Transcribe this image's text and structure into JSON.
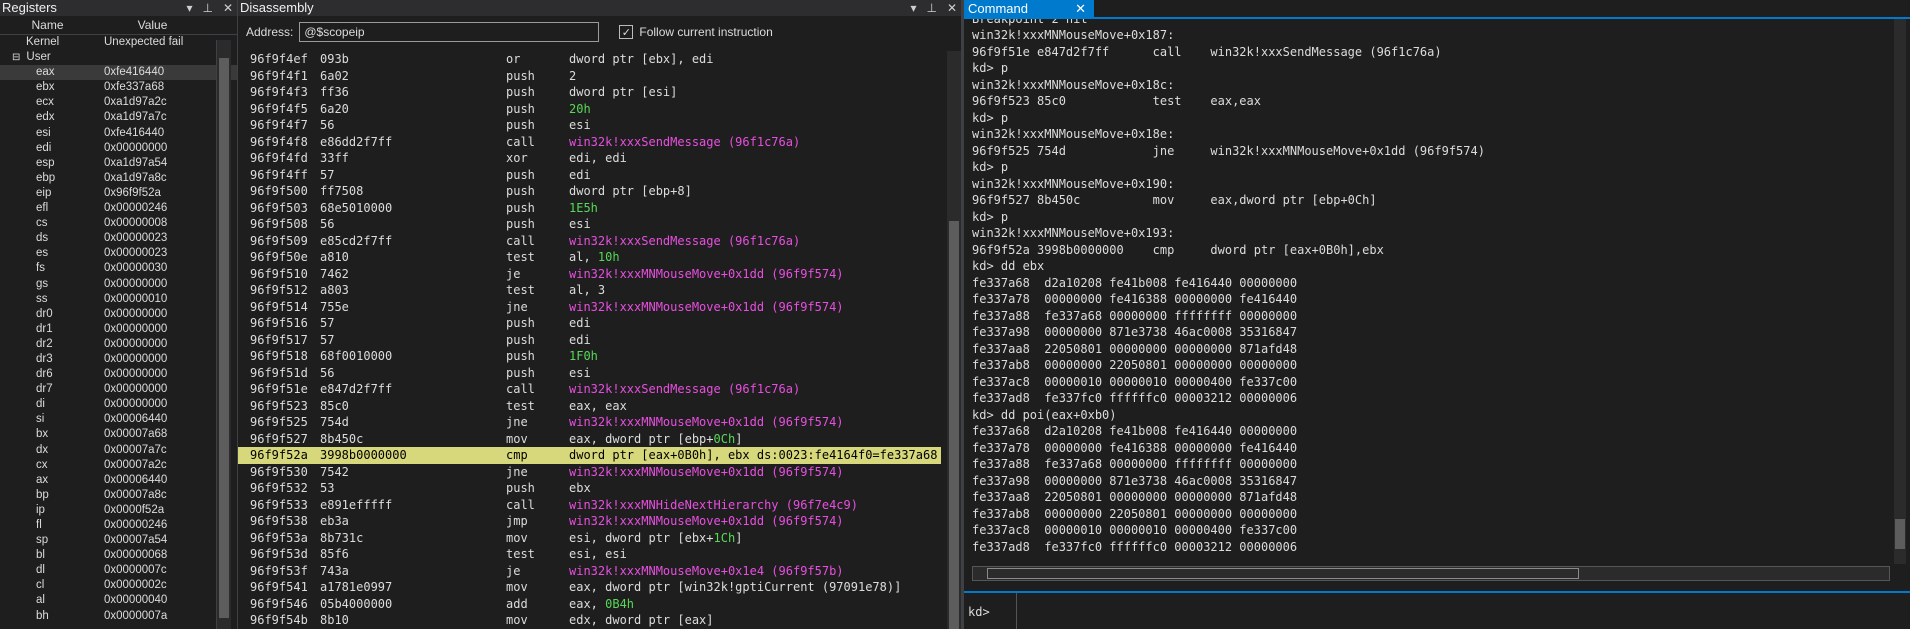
{
  "registers": {
    "title": "Registers",
    "col_name": "Name",
    "col_value": "Value",
    "kernel_row": {
      "name": "Kernel",
      "value": "Unexpected fail"
    },
    "group": "User",
    "rows": [
      {
        "name": "eax",
        "value": "0xfe416440"
      },
      {
        "name": "ebx",
        "value": "0xfe337a68"
      },
      {
        "name": "ecx",
        "value": "0xa1d97a2c"
      },
      {
        "name": "edx",
        "value": "0xa1d97a7c"
      },
      {
        "name": "esi",
        "value": "0xfe416440"
      },
      {
        "name": "edi",
        "value": "0x00000000"
      },
      {
        "name": "esp",
        "value": "0xa1d97a54"
      },
      {
        "name": "ebp",
        "value": "0xa1d97a8c"
      },
      {
        "name": "eip",
        "value": "0x96f9f52a"
      },
      {
        "name": "efl",
        "value": "0x00000246"
      },
      {
        "name": "cs",
        "value": "0x00000008"
      },
      {
        "name": "ds",
        "value": "0x00000023"
      },
      {
        "name": "es",
        "value": "0x00000023"
      },
      {
        "name": "fs",
        "value": "0x00000030"
      },
      {
        "name": "gs",
        "value": "0x00000000"
      },
      {
        "name": "ss",
        "value": "0x00000010"
      },
      {
        "name": "dr0",
        "value": "0x00000000"
      },
      {
        "name": "dr1",
        "value": "0x00000000"
      },
      {
        "name": "dr2",
        "value": "0x00000000"
      },
      {
        "name": "dr3",
        "value": "0x00000000"
      },
      {
        "name": "dr6",
        "value": "0x00000000"
      },
      {
        "name": "dr7",
        "value": "0x00000000"
      },
      {
        "name": "di",
        "value": "0x00000000"
      },
      {
        "name": "si",
        "value": "0x00006440"
      },
      {
        "name": "bx",
        "value": "0x00007a68"
      },
      {
        "name": "dx",
        "value": "0x00007a7c"
      },
      {
        "name": "cx",
        "value": "0x00007a2c"
      },
      {
        "name": "ax",
        "value": "0x00006440"
      },
      {
        "name": "bp",
        "value": "0x00007a8c"
      },
      {
        "name": "ip",
        "value": "0x0000f52a"
      },
      {
        "name": "fl",
        "value": "0x00000246"
      },
      {
        "name": "sp",
        "value": "0x00007a54"
      },
      {
        "name": "bl",
        "value": "0x00000068"
      },
      {
        "name": "dl",
        "value": "0x0000007c"
      },
      {
        "name": "cl",
        "value": "0x0000002c"
      },
      {
        "name": "al",
        "value": "0x00000040"
      },
      {
        "name": "bh",
        "value": "0x0000007a"
      }
    ]
  },
  "disassembly": {
    "title": "Disassembly",
    "address_label": "Address:",
    "address_value": "@$scopeip",
    "follow_label": "Follow current instruction",
    "lines": [
      {
        "addr": "96f9f4ef",
        "bytes": "093b",
        "mn": "or",
        "op": "dword ptr [ebx], edi",
        "kind": "plain"
      },
      {
        "addr": "96f9f4f1",
        "bytes": "6a02",
        "mn": "push",
        "op": "2",
        "kind": "plain"
      },
      {
        "addr": "96f9f4f3",
        "bytes": "ff36",
        "mn": "push",
        "op": "dword ptr [esi]",
        "kind": "plain"
      },
      {
        "addr": "96f9f4f5",
        "bytes": "6a20",
        "mn": "push",
        "op": "20h",
        "kind": "grn"
      },
      {
        "addr": "96f9f4f7",
        "bytes": "56",
        "mn": "push",
        "op": "esi",
        "kind": "plain"
      },
      {
        "addr": "96f9f4f8",
        "bytes": "e86dd2f7ff",
        "mn": "call",
        "op": "win32k!xxxSendMessage (96f1c76a)",
        "kind": "pink"
      },
      {
        "addr": "96f9f4fd",
        "bytes": "33ff",
        "mn": "xor",
        "op": "edi, edi",
        "kind": "plain"
      },
      {
        "addr": "96f9f4ff",
        "bytes": "57",
        "mn": "push",
        "op": "edi",
        "kind": "plain"
      },
      {
        "addr": "96f9f500",
        "bytes": "ff7508",
        "mn": "push",
        "op": "dword ptr [ebp+8]",
        "kind": "plain"
      },
      {
        "addr": "96f9f503",
        "bytes": "68e5010000",
        "mn": "push",
        "op": "1E5h",
        "kind": "grn"
      },
      {
        "addr": "96f9f508",
        "bytes": "56",
        "mn": "push",
        "op": "esi",
        "kind": "plain"
      },
      {
        "addr": "96f9f509",
        "bytes": "e85cd2f7ff",
        "mn": "call",
        "op": "win32k!xxxSendMessage (96f1c76a)",
        "kind": "pink"
      },
      {
        "addr": "96f9f50e",
        "bytes": "a810",
        "mn": "test",
        "op": "al, ",
        "op2": "10h",
        "kind": "mixed"
      },
      {
        "addr": "96f9f510",
        "bytes": "7462",
        "mn": "je",
        "op": "win32k!xxxMNMouseMove+0x1dd (96f9f574)",
        "kind": "pink"
      },
      {
        "addr": "96f9f512",
        "bytes": "a803",
        "mn": "test",
        "op": "al, 3",
        "kind": "plain"
      },
      {
        "addr": "96f9f514",
        "bytes": "755e",
        "mn": "jne",
        "op": "win32k!xxxMNMouseMove+0x1dd (96f9f574)",
        "kind": "pink"
      },
      {
        "addr": "96f9f516",
        "bytes": "57",
        "mn": "push",
        "op": "edi",
        "kind": "plain"
      },
      {
        "addr": "96f9f517",
        "bytes": "57",
        "mn": "push",
        "op": "edi",
        "kind": "plain"
      },
      {
        "addr": "96f9f518",
        "bytes": "68f0010000",
        "mn": "push",
        "op": "1F0h",
        "kind": "grn"
      },
      {
        "addr": "96f9f51d",
        "bytes": "56",
        "mn": "push",
        "op": "esi",
        "kind": "plain"
      },
      {
        "addr": "96f9f51e",
        "bytes": "e847d2f7ff",
        "mn": "call",
        "op": "win32k!xxxSendMessage (96f1c76a)",
        "kind": "pink"
      },
      {
        "addr": "96f9f523",
        "bytes": "85c0",
        "mn": "test",
        "op": "eax, eax",
        "kind": "plain"
      },
      {
        "addr": "96f9f525",
        "bytes": "754d",
        "mn": "jne",
        "op": "win32k!xxxMNMouseMove+0x1dd (96f9f574)",
        "kind": "pink"
      },
      {
        "addr": "96f9f527",
        "bytes": "8b450c",
        "mn": "mov",
        "op": "eax, dword ptr [ebp+",
        "op2": "0Ch",
        "op3": "]",
        "kind": "mixed3"
      },
      {
        "addr": "96f9f52a",
        "bytes": "3998b0000000",
        "mn": "cmp",
        "op": "dword ptr [eax+0B0h], ebx ds:0023:fe4164f0=fe337a68",
        "kind": "cur"
      },
      {
        "addr": "96f9f530",
        "bytes": "7542",
        "mn": "jne",
        "op": "win32k!xxxMNMouseMove+0x1dd (96f9f574)",
        "kind": "pink"
      },
      {
        "addr": "96f9f532",
        "bytes": "53",
        "mn": "push",
        "op": "ebx",
        "kind": "plain"
      },
      {
        "addr": "96f9f533",
        "bytes": "e891efffff",
        "mn": "call",
        "op": "win32k!xxxMNHideNextHierarchy (96f7e4c9)",
        "kind": "pink"
      },
      {
        "addr": "96f9f538",
        "bytes": "eb3a",
        "mn": "jmp",
        "op": "win32k!xxxMNMouseMove+0x1dd (96f9f574)",
        "kind": "pink"
      },
      {
        "addr": "96f9f53a",
        "bytes": "8b731c",
        "mn": "mov",
        "op": "esi, dword ptr [ebx+",
        "op2": "1Ch",
        "op3": "]",
        "kind": "mixed3"
      },
      {
        "addr": "96f9f53d",
        "bytes": "85f6",
        "mn": "test",
        "op": "esi, esi",
        "kind": "plain"
      },
      {
        "addr": "96f9f53f",
        "bytes": "743a",
        "mn": "je",
        "op": "win32k!xxxMNMouseMove+0x1e4 (96f9f57b)",
        "kind": "pink"
      },
      {
        "addr": "96f9f541",
        "bytes": "a1781e0997",
        "mn": "mov",
        "op": "eax, dword ptr [win32k!gptiCurrent (97091e78)]",
        "kind": "plain"
      },
      {
        "addr": "96f9f546",
        "bytes": "05b4000000",
        "mn": "add",
        "op": "eax, ",
        "op2": "0B4h",
        "kind": "mixed"
      },
      {
        "addr": "96f9f54b",
        "bytes": "8b10",
        "mn": "mov",
        "op": "edx, dword ptr [eax]",
        "kind": "plain"
      }
    ]
  },
  "command": {
    "title": "Command",
    "lines": [
      "Breakpoint 2 hit",
      "win32k!xxxMNMouseMove+0x187:",
      "96f9f51e e847d2f7ff      call    win32k!xxxSendMessage (96f1c76a)",
      "kd> p",
      "win32k!xxxMNMouseMove+0x18c:",
      "96f9f523 85c0            test    eax,eax",
      "kd> p",
      "win32k!xxxMNMouseMove+0x18e:",
      "96f9f525 754d            jne     win32k!xxxMNMouseMove+0x1dd (96f9f574)",
      "kd> p",
      "win32k!xxxMNMouseMove+0x190:",
      "96f9f527 8b450c          mov     eax,dword ptr [ebp+0Ch]",
      "kd> p",
      "win32k!xxxMNMouseMove+0x193:",
      "96f9f52a 3998b0000000    cmp     dword ptr [eax+0B0h],ebx",
      "kd> dd ebx",
      "fe337a68  d2a10208 fe41b008 fe416440 00000000",
      "fe337a78  00000000 fe416388 00000000 fe416440",
      "fe337a88  fe337a68 00000000 ffffffff 00000000",
      "fe337a98  00000000 871e3738 46ac0008 35316847",
      "fe337aa8  22050801 00000000 00000000 871afd48",
      "fe337ab8  00000000 22050801 00000000 00000000",
      "fe337ac8  00000010 00000010 00000400 fe337c00",
      "fe337ad8  fe337fc0 ffffffc0 00003212 00000006",
      "kd> dd poi(eax+0xb0)",
      "fe337a68  d2a10208 fe41b008 fe416440 00000000",
      "fe337a78  00000000 fe416388 00000000 fe416440",
      "fe337a88  fe337a68 00000000 ffffffff 00000000",
      "fe337a98  00000000 871e3738 46ac0008 35316847",
      "fe337aa8  22050801 00000000 00000000 871afd48",
      "fe337ab8  00000000 22050801 00000000 00000000",
      "fe337ac8  00000010 00000010 00000400 fe337c00",
      "fe337ad8  fe337fc0 ffffffc0 00003212 00000006"
    ],
    "prompt": "kd>"
  }
}
